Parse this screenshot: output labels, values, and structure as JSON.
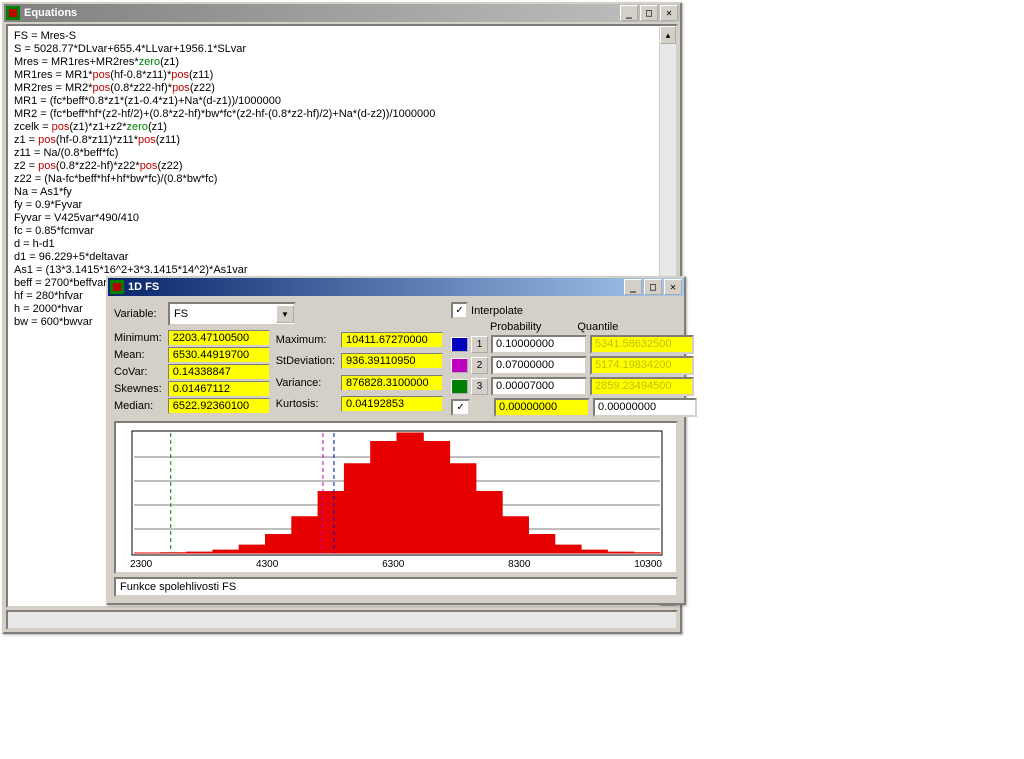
{
  "equations_window": {
    "title": "Equations",
    "lines_raw": [
      [
        "FS = Mres-S"
      ],
      [
        "S = 5028.77*DLvar+655.4*LLvar+1956.1*SLvar"
      ],
      [
        "Mres = MR1res+MR2res*",
        {
          "t": "zero",
          "c": "zero"
        },
        "(z1)"
      ],
      [
        "MR1res = MR1*",
        {
          "t": "pos",
          "c": "pos"
        },
        "(hf-0.8*z11)*",
        {
          "t": "pos",
          "c": "pos"
        },
        "(z11)"
      ],
      [
        "MR2res = MR2*",
        {
          "t": "pos",
          "c": "pos"
        },
        "(0.8*z22-hf)*",
        {
          "t": "pos",
          "c": "pos"
        },
        "(z22)"
      ],
      [
        "MR1 = (fc*beff*0.8*z1*(z1-0.4*z1)+Na*(d-z1))/1000000"
      ],
      [
        "MR2 = (fc*beff*hf*(z2-hf/2)+(0.8*z2-hf)*bw*fc*(z2-hf-(0.8*z2-hf)/2)+Na*(d-z2))/1000000"
      ],
      [
        "zcelk = ",
        {
          "t": "pos",
          "c": "pos"
        },
        "(z1)*z1+z2*",
        {
          "t": "zero",
          "c": "zero"
        },
        "(z1)"
      ],
      [
        "z1 = ",
        {
          "t": "pos",
          "c": "pos"
        },
        "(hf-0.8*z11)*z11*",
        {
          "t": "pos",
          "c": "pos"
        },
        "(z11)"
      ],
      [
        "z11 = Na/(0.8*beff*fc)"
      ],
      [
        "z2 = ",
        {
          "t": "pos",
          "c": "pos"
        },
        "(0.8*z22-hf)*z22*",
        {
          "t": "pos",
          "c": "pos"
        },
        "(z22)"
      ],
      [
        "z22 = (Na-fc*beff*hf+hf*bw*fc)/(0.8*bw*fc)"
      ],
      [
        "Na = As1*fy"
      ],
      [
        "fy = 0.9*Fyvar"
      ],
      [
        "Fyvar = V425var*490/410"
      ],
      [
        "fc = 0.85*fcmvar"
      ],
      [
        "d = h-d1"
      ],
      [
        "d1 = 96.229+5*deltavar"
      ],
      [
        "As1 = (13*3.1415*16^2+3*3.1415*14^2)*As1var"
      ],
      [
        "beff = 2700*beffvar"
      ],
      [
        "hf = 280*hfvar"
      ],
      [
        "h = 2000*hvar"
      ],
      [
        "bw = 600*bwvar"
      ]
    ]
  },
  "fs_window": {
    "title": "1D FS",
    "variable_label": "Variable:",
    "variable_value": "FS",
    "interpolate_label": "Interpolate",
    "probability_label": "Probability",
    "quantile_label": "Quantile",
    "stats": {
      "min_label": "Minimum:",
      "min": "2203.47100500",
      "mean_label": "Mean:",
      "mean": "6530.44919700",
      "covar_label": "CoVar:",
      "covar": "0.14338847",
      "skew_label": "Skewnes:",
      "skew": "0.01467112",
      "median_label": "Median:",
      "median": "6522.92360100",
      "max_label": "Maximum:",
      "max": "10411.67270000",
      "std_label": "StDeviation:",
      "std": "936.39110950",
      "var_label": "Variance:",
      "var": "876828.3100000",
      "kurt_label": "Kurtosis:",
      "kurt": "0.04192853"
    },
    "prob_rows": [
      {
        "color": "#0000c0",
        "idx": "1",
        "prob": "0.10000000",
        "quant": "5341.58632500"
      },
      {
        "color": "#c000c0",
        "idx": "2",
        "prob": "0.07000000",
        "quant": "5174.19834200"
      },
      {
        "color": "#008000",
        "idx": "3",
        "prob": "0.00007000",
        "quant": "2859.23494500"
      },
      {
        "color": "#000080",
        "idx": "",
        "prob": "0.00000000",
        "quant": "0.00000000",
        "checked": true
      }
    ],
    "status": "Funkce spolehlivosti FS"
  },
  "chart_data": {
    "type": "area",
    "title": "",
    "xlabel": "",
    "ylabel": "",
    "xlim": [
      2300,
      10300
    ],
    "x_ticks": [
      2300,
      4300,
      6300,
      8300,
      10300
    ],
    "x": [
      2300,
      2700,
      3100,
      3500,
      3900,
      4300,
      4700,
      5100,
      5500,
      5900,
      6300,
      6700,
      7100,
      7500,
      7900,
      8300,
      8700,
      9100,
      9500,
      9900,
      10300
    ],
    "values": [
      0.0,
      0.001,
      0.003,
      0.01,
      0.027,
      0.063,
      0.124,
      0.21,
      0.305,
      0.381,
      0.41,
      0.381,
      0.305,
      0.21,
      0.124,
      0.063,
      0.027,
      0.01,
      0.003,
      0.001,
      0.0
    ],
    "vlines": [
      {
        "x": 2859,
        "color": "#008000",
        "dash": "4 3"
      },
      {
        "x": 5174,
        "color": "#c000c0",
        "dash": "4 3"
      },
      {
        "x": 5341,
        "color": "#0000c0",
        "dash": "4 3"
      }
    ],
    "grid": {
      "hlines": 5
    }
  }
}
